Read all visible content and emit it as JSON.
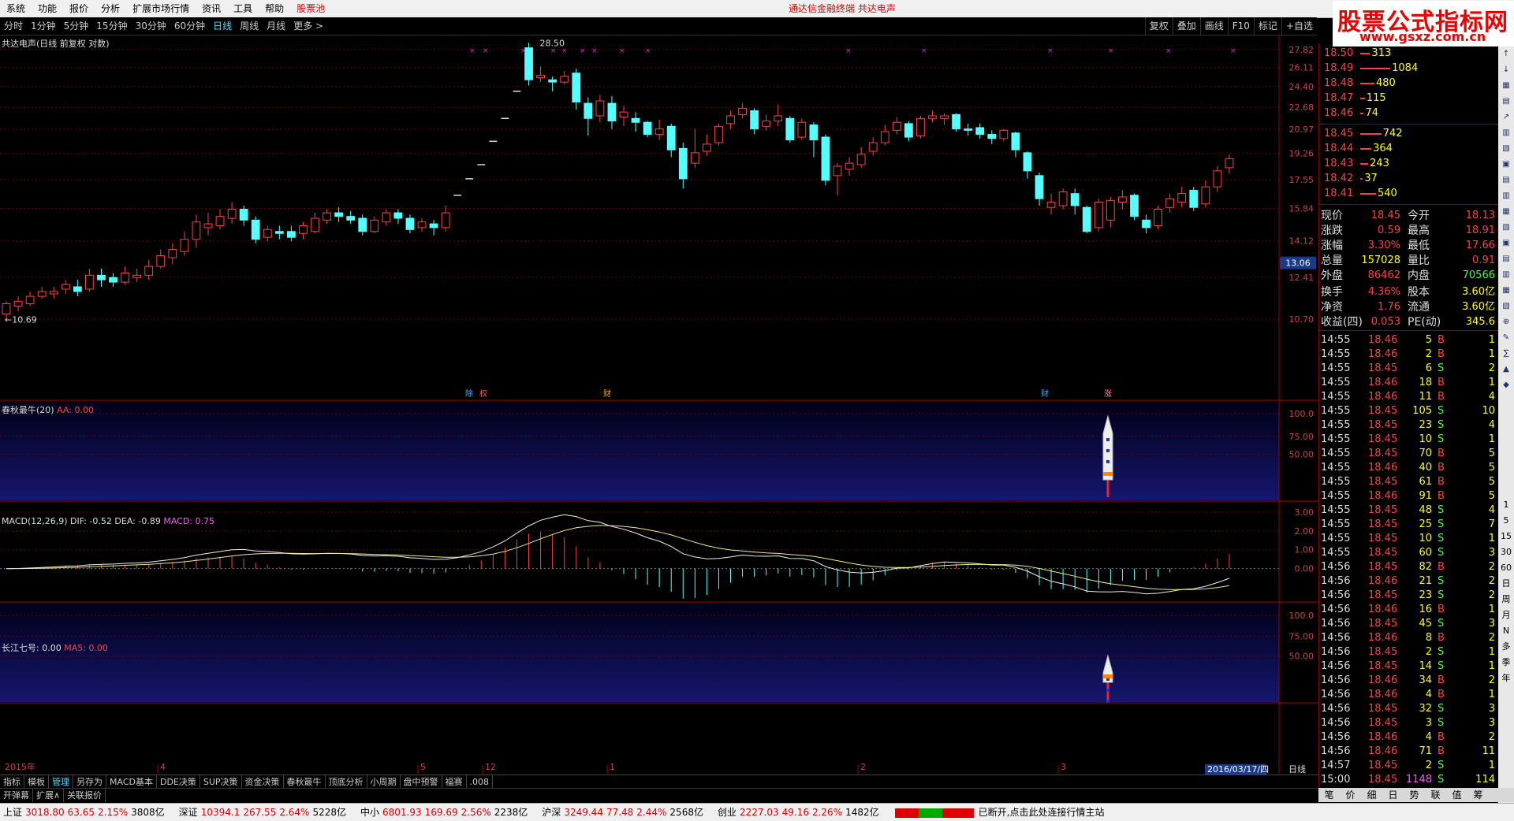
{
  "menu": [
    "系统",
    "功能",
    "报价",
    "分析",
    "扩展市场行情",
    "资讯",
    "工具",
    "帮助",
    "股票池"
  ],
  "center_title": "通达信金融终端   共达电声",
  "watermark": {
    "title": "股票公式指标网",
    "url": "www.gsxz.com.cn"
  },
  "periods": [
    "分时",
    "1分钟",
    "5分钟",
    "15分钟",
    "30分钟",
    "60分钟",
    "日线",
    "周线",
    "月线",
    "更多 >"
  ],
  "active_period": "日线",
  "right_tools": [
    "复权",
    "叠加",
    "画线",
    "F10",
    "标记",
    "+自选"
  ],
  "main_title": "共达电声(日线 前复权 对数)",
  "price_axis": [
    "27.82",
    "26.11",
    "24.40",
    "22.68",
    "20.97",
    "19.26",
    "17.55",
    "15.84",
    "14.12",
    "12.41",
    "10.70"
  ],
  "price_marker": "13.06",
  "high_label": "28.50",
  "low_label": "10.69",
  "candles": [
    [
      10.9,
      11.3,
      10.69,
      11.4
    ],
    [
      11.2,
      11.4,
      11.0,
      11.6
    ],
    [
      11.3,
      11.6,
      11.2,
      11.8
    ],
    [
      11.6,
      11.8,
      11.5,
      12.0
    ],
    [
      11.7,
      11.8,
      11.5,
      12.0
    ],
    [
      11.9,
      12.1,
      11.7,
      12.3
    ],
    [
      12.0,
      11.8,
      11.6,
      12.3
    ],
    [
      11.9,
      12.5,
      11.8,
      12.8
    ],
    [
      12.5,
      12.3,
      12.0,
      12.8
    ],
    [
      12.4,
      12.2,
      12.0,
      12.6
    ],
    [
      12.2,
      12.6,
      12.1,
      12.9
    ],
    [
      12.4,
      12.5,
      12.2,
      12.8
    ],
    [
      12.5,
      12.9,
      12.3,
      13.2
    ],
    [
      12.9,
      13.4,
      12.8,
      13.7
    ],
    [
      13.3,
      13.7,
      13.0,
      14.0
    ],
    [
      13.6,
      14.2,
      13.4,
      14.6
    ],
    [
      14.2,
      15.1,
      13.8,
      15.5
    ],
    [
      14.8,
      15.0,
      14.4,
      15.6
    ],
    [
      14.9,
      15.4,
      14.7,
      15.8
    ],
    [
      15.3,
      15.8,
      15.0,
      16.2
    ],
    [
      15.8,
      15.2,
      14.9,
      16.0
    ],
    [
      15.2,
      14.2,
      14.0,
      15.4
    ],
    [
      14.3,
      14.7,
      14.1,
      14.9
    ],
    [
      14.6,
      14.5,
      14.2,
      14.9
    ],
    [
      14.6,
      14.3,
      14.1,
      14.9
    ],
    [
      14.5,
      14.9,
      14.2,
      15.1
    ],
    [
      14.6,
      15.3,
      14.5,
      15.6
    ],
    [
      15.2,
      15.6,
      15.0,
      15.8
    ],
    [
      15.6,
      15.4,
      15.1,
      15.9
    ],
    [
      15.4,
      15.2,
      15.0,
      15.7
    ],
    [
      15.3,
      14.6,
      14.4,
      15.5
    ],
    [
      14.6,
      15.2,
      14.5,
      15.4
    ],
    [
      15.1,
      15.6,
      14.9,
      15.8
    ],
    [
      15.6,
      15.3,
      15.0,
      15.8
    ],
    [
      15.3,
      14.7,
      14.5,
      15.5
    ],
    [
      14.8,
      15.1,
      14.6,
      15.3
    ],
    [
      15.0,
      14.8,
      14.4,
      15.2
    ],
    [
      14.8,
      15.6,
      14.6,
      16.0
    ],
    [
      16.6,
      16.6,
      16.6,
      16.6
    ],
    [
      17.6,
      17.6,
      17.6,
      17.6
    ],
    [
      18.5,
      18.5,
      18.5,
      18.5
    ],
    [
      20.1,
      20.1,
      20.1,
      20.1
    ],
    [
      21.8,
      21.8,
      21.8,
      21.8
    ],
    [
      24.0,
      24.0,
      24.0,
      24.0
    ],
    [
      28.0,
      25.0,
      24.5,
      28.5
    ],
    [
      25.2,
      25.4,
      24.8,
      26.2
    ],
    [
      25.0,
      24.8,
      24.0,
      25.3
    ],
    [
      24.8,
      25.3,
      24.6,
      25.8
    ],
    [
      25.6,
      23.1,
      22.5,
      26.0
    ],
    [
      23.0,
      21.8,
      20.5,
      23.5
    ],
    [
      22.0,
      23.2,
      21.5,
      23.7
    ],
    [
      23.0,
      21.6,
      21.0,
      23.6
    ],
    [
      21.9,
      22.3,
      21.2,
      22.8
    ],
    [
      21.8,
      21.5,
      20.8,
      22.3
    ],
    [
      21.5,
      20.6,
      20.4,
      21.6
    ],
    [
      20.6,
      21.0,
      20.2,
      21.7
    ],
    [
      21.2,
      19.5,
      19.0,
      21.4
    ],
    [
      19.6,
      17.6,
      17.0,
      20.0
    ],
    [
      18.6,
      19.3,
      18.3,
      21.0
    ],
    [
      19.4,
      19.9,
      19.1,
      20.6
    ],
    [
      20.0,
      21.2,
      19.8,
      21.4
    ],
    [
      21.4,
      22.0,
      21.0,
      22.4
    ],
    [
      22.1,
      22.6,
      21.8,
      23.0
    ],
    [
      22.4,
      21.0,
      20.6,
      22.6
    ],
    [
      21.2,
      21.6,
      20.9,
      22.1
    ],
    [
      21.6,
      22.0,
      21.2,
      22.9
    ],
    [
      21.8,
      20.2,
      20.0,
      22.0
    ],
    [
      20.4,
      21.5,
      20.2,
      21.8
    ],
    [
      21.3,
      20.2,
      19.0,
      21.5
    ],
    [
      20.4,
      17.5,
      17.2,
      20.6
    ],
    [
      17.8,
      18.4,
      16.6,
      18.6
    ],
    [
      18.2,
      18.6,
      17.8,
      19.0
    ],
    [
      18.5,
      19.2,
      18.3,
      19.7
    ],
    [
      19.4,
      20.0,
      19.1,
      20.4
    ],
    [
      20.0,
      20.8,
      19.8,
      21.3
    ],
    [
      20.9,
      21.5,
      20.6,
      21.9
    ],
    [
      21.4,
      20.4,
      20.1,
      21.6
    ],
    [
      20.5,
      21.8,
      20.3,
      22.0
    ],
    [
      21.8,
      22.0,
      21.5,
      22.4
    ],
    [
      21.8,
      22.0,
      21.3,
      22.2
    ],
    [
      22.1,
      21.0,
      20.8,
      22.2
    ],
    [
      21.0,
      20.9,
      20.5,
      21.4
    ],
    [
      21.1,
      20.6,
      20.3,
      21.4
    ],
    [
      20.6,
      20.3,
      19.9,
      20.9
    ],
    [
      20.3,
      20.9,
      20.1,
      21.0
    ],
    [
      20.7,
      19.5,
      19.0,
      20.8
    ],
    [
      19.3,
      18.1,
      17.6,
      19.4
    ],
    [
      17.8,
      16.4,
      16.0,
      18.0
    ],
    [
      15.9,
      16.2,
      15.5,
      16.7
    ],
    [
      16.0,
      16.8,
      15.8,
      17.0
    ],
    [
      16.7,
      16.0,
      15.5,
      17.0
    ],
    [
      15.9,
      14.6,
      14.5,
      16.0
    ],
    [
      14.8,
      16.2,
      14.6,
      16.4
    ],
    [
      15.2,
      16.3,
      14.8,
      16.5
    ],
    [
      16.2,
      16.5,
      15.8,
      16.9
    ],
    [
      16.6,
      15.4,
      15.2,
      16.7
    ],
    [
      15.2,
      14.8,
      14.5,
      15.5
    ],
    [
      14.9,
      15.8,
      14.7,
      16.0
    ],
    [
      15.9,
      16.4,
      15.6,
      16.7
    ],
    [
      16.2,
      16.7,
      15.9,
      17.1
    ],
    [
      16.9,
      15.9,
      15.7,
      17.1
    ],
    [
      16.1,
      17.1,
      15.9,
      17.5
    ],
    [
      17.1,
      18.1,
      16.8,
      18.4
    ],
    [
      18.3,
      18.9,
      17.9,
      19.2
    ]
  ],
  "event_markers": [
    "除",
    "权",
    "财",
    "涨"
  ],
  "ind1": {
    "title": "春秋最牛(20)",
    "aa_label": "AA: 0.00",
    "axis": [
      "100.0",
      "75.00",
      "50.00"
    ]
  },
  "macd": {
    "title": "MACD(12,26,9)",
    "dif": "DIF: -0.52",
    "dea": "DEA: -0.89",
    "macd": "MACD: 0.75",
    "axis": [
      "3.00",
      "2.00",
      "1.00",
      "0.00"
    ]
  },
  "ind3": {
    "title": "长江七号:",
    "val": "0.00",
    "ma5": "MA5: 0.00",
    "axis": [
      "100.0",
      "75.00",
      "50.00"
    ]
  },
  "xaxis": {
    "left": "2015年",
    "ticks": [
      "4",
      "5",
      "12",
      "1",
      "2",
      "3"
    ],
    "date": "2016/03/17/四",
    "period": "日线"
  },
  "orderbook_sell": [
    [
      "18.50",
      "313"
    ],
    [
      "18.49",
      "1084"
    ],
    [
      "18.48",
      "480"
    ],
    [
      "18.47",
      "115"
    ],
    [
      "18.46",
      "74"
    ]
  ],
  "orderbook_buy": [
    [
      "18.45",
      "742"
    ],
    [
      "18.44",
      "364"
    ],
    [
      "18.43",
      "243"
    ],
    [
      "18.42",
      "37"
    ],
    [
      "18.41",
      "540"
    ]
  ],
  "quote": [
    [
      "现价",
      "18.45",
      "今开",
      "18.13"
    ],
    [
      "涨跌",
      "0.59",
      "最高",
      "18.91"
    ],
    [
      "涨幅",
      "3.30%",
      "最低",
      "17.66"
    ],
    [
      "总量",
      "157028",
      "量比",
      "0.91"
    ],
    [
      "外盘",
      "86462",
      "内盘",
      "70566"
    ],
    [
      "换手",
      "4.36%",
      "股本",
      "3.60亿"
    ],
    [
      "净资",
      "1.76",
      "流通",
      "3.60亿"
    ],
    [
      "收益(四)",
      "0.053",
      "PE(动)",
      "345.6"
    ]
  ],
  "ticks": [
    [
      "14:55",
      "18.46",
      "5",
      "B",
      "1"
    ],
    [
      "14:55",
      "18.46",
      "2",
      "B",
      "1"
    ],
    [
      "14:55",
      "18.45",
      "6",
      "S",
      "2"
    ],
    [
      "14:55",
      "18.46",
      "18",
      "B",
      "1"
    ],
    [
      "14:55",
      "18.46",
      "11",
      "B",
      "4"
    ],
    [
      "14:55",
      "18.45",
      "105",
      "S",
      "10"
    ],
    [
      "14:55",
      "18.45",
      "23",
      "S",
      "4"
    ],
    [
      "14:55",
      "18.45",
      "10",
      "S",
      "1"
    ],
    [
      "14:55",
      "18.45",
      "70",
      "B",
      "5"
    ],
    [
      "14:55",
      "18.46",
      "40",
      "B",
      "5"
    ],
    [
      "14:55",
      "18.45",
      "61",
      "B",
      "5"
    ],
    [
      "14:55",
      "18.46",
      "91",
      "B",
      "5"
    ],
    [
      "14:55",
      "18.45",
      "48",
      "S",
      "4"
    ],
    [
      "14:55",
      "18.45",
      "25",
      "S",
      "7"
    ],
    [
      "14:55",
      "18.45",
      "10",
      "S",
      "1"
    ],
    [
      "14:55",
      "18.45",
      "60",
      "S",
      "3"
    ],
    [
      "14:56",
      "18.45",
      "82",
      "B",
      "2"
    ],
    [
      "14:56",
      "18.46",
      "21",
      "S",
      "2"
    ],
    [
      "14:56",
      "18.45",
      "23",
      "S",
      "2"
    ],
    [
      "14:56",
      "18.46",
      "16",
      "B",
      "1"
    ],
    [
      "14:56",
      "18.45",
      "45",
      "S",
      "3"
    ],
    [
      "14:56",
      "18.46",
      "8",
      "B",
      "2"
    ],
    [
      "14:56",
      "18.45",
      "2",
      "S",
      "1"
    ],
    [
      "14:56",
      "18.45",
      "14",
      "S",
      "1"
    ],
    [
      "14:56",
      "18.46",
      "34",
      "B",
      "2"
    ],
    [
      "14:56",
      "18.46",
      "4",
      "B",
      "1"
    ],
    [
      "14:56",
      "18.45",
      "32",
      "S",
      "3"
    ],
    [
      "14:56",
      "18.45",
      "3",
      "S",
      "3"
    ],
    [
      "14:56",
      "18.46",
      "4",
      "B",
      "2"
    ],
    [
      "14:56",
      "18.46",
      "71",
      "B",
      "11"
    ],
    [
      "14:57",
      "18.45",
      "2",
      "S",
      "1"
    ],
    [
      "15:00",
      "18.45",
      "1148",
      "S",
      "114"
    ]
  ],
  "tabs": [
    "指标",
    "模板",
    "管理",
    "另存为",
    "MACD基本",
    "DDE决策",
    "SUP决策",
    "资金决策",
    "春秋最牛",
    "顶底分析",
    "小周期",
    "盘中预警",
    "福赛",
    ".008"
  ],
  "tabs2": [
    "开弹幕",
    "扩展∧",
    "关联报价"
  ],
  "right_tabs": [
    "笔",
    "价",
    "细",
    "日",
    "势",
    "联",
    "值",
    "筹"
  ],
  "status": [
    {
      "name": "上证",
      "v": "3018.80",
      "c": "63.65",
      "p": "2.15%",
      "amt": "3808亿"
    },
    {
      "name": "深证",
      "v": "10394.1",
      "c": "267.55",
      "p": "2.64%",
      "amt": "5228亿"
    },
    {
      "name": "中小",
      "v": "6801.93",
      "c": "169.69",
      "p": "2.56%",
      "amt": "2238亿"
    },
    {
      "name": "沪深",
      "v": "3249.44",
      "c": "77.48",
      "p": "2.44%",
      "amt": "2568亿"
    },
    {
      "name": "创业",
      "v": "2227.03",
      "c": "49.16",
      "p": "2.26%",
      "amt": "1482亿"
    }
  ],
  "status_msg": "已断开,点击此处连接行情主站",
  "colors": {
    "up": "#ff4040",
    "down": "#54ffff",
    "grid": "#8b0000",
    "panel_bg_top": "#000020",
    "panel_bg_bottom": "#141466"
  }
}
